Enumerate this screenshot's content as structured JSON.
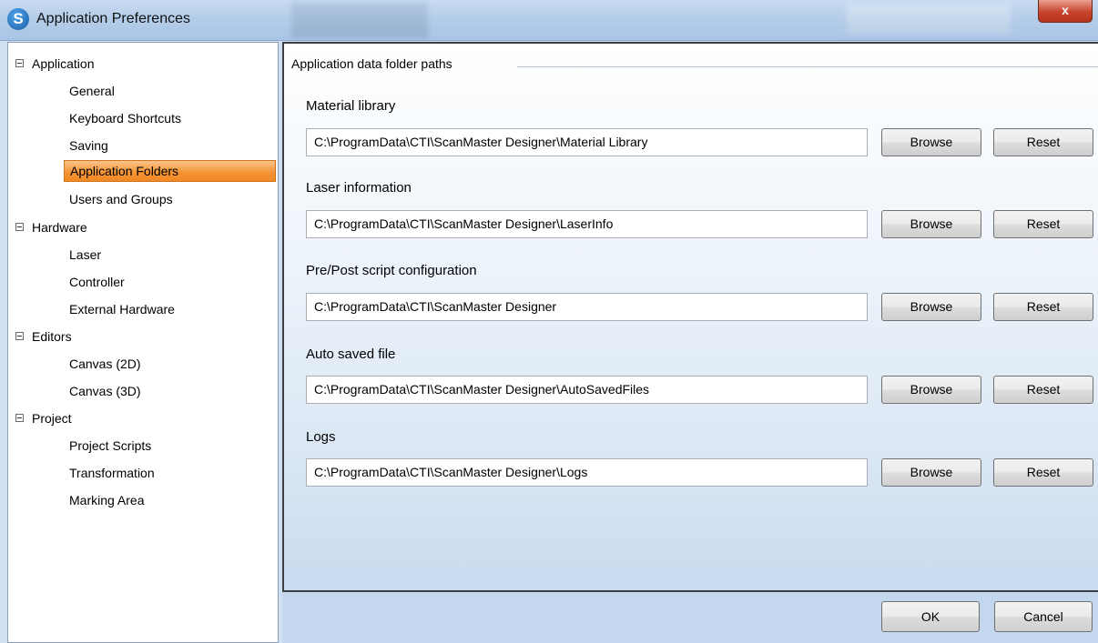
{
  "window": {
    "title": "Application Preferences",
    "close_glyph": "x"
  },
  "tree": {
    "groups": [
      {
        "label": "Application",
        "items": [
          "General",
          "Keyboard Shortcuts",
          "Saving",
          "Application Folders",
          "Users and Groups"
        ]
      },
      {
        "label": "Hardware",
        "items": [
          "Laser",
          "Controller",
          "External Hardware"
        ]
      },
      {
        "label": "Editors",
        "items": [
          "Canvas (2D)",
          "Canvas (3D)"
        ]
      },
      {
        "label": "Project",
        "items": [
          "Project Scripts",
          "Transformation",
          "Marking Area"
        ]
      }
    ],
    "selected": "Application Folders"
  },
  "main": {
    "section_title": "Application data folder paths",
    "folders": [
      {
        "label": "Material library",
        "path": "C:\\ProgramData\\CTI\\ScanMaster Designer\\Material Library",
        "browse": "Browse",
        "reset": "Reset"
      },
      {
        "label": "Laser information",
        "path": "C:\\ProgramData\\CTI\\ScanMaster Designer\\LaserInfo",
        "browse": "Browse",
        "reset": "Reset"
      },
      {
        "label": "Pre/Post script configuration",
        "path": "C:\\ProgramData\\CTI\\ScanMaster Designer",
        "browse": "Browse",
        "reset": "Reset"
      },
      {
        "label": "Auto saved file",
        "path": "C:\\ProgramData\\CTI\\ScanMaster Designer\\AutoSavedFiles",
        "browse": "Browse",
        "reset": "Reset"
      },
      {
        "label": "Logs",
        "path": "C:\\ProgramData\\CTI\\ScanMaster Designer\\Logs",
        "browse": "Browse",
        "reset": "Reset"
      }
    ]
  },
  "footer": {
    "ok_label": "OK",
    "cancel_label": "Cancel"
  },
  "colors": {
    "selection": "#f59233",
    "titlebar": "#b4cde9",
    "close_button": "#c7432b"
  }
}
